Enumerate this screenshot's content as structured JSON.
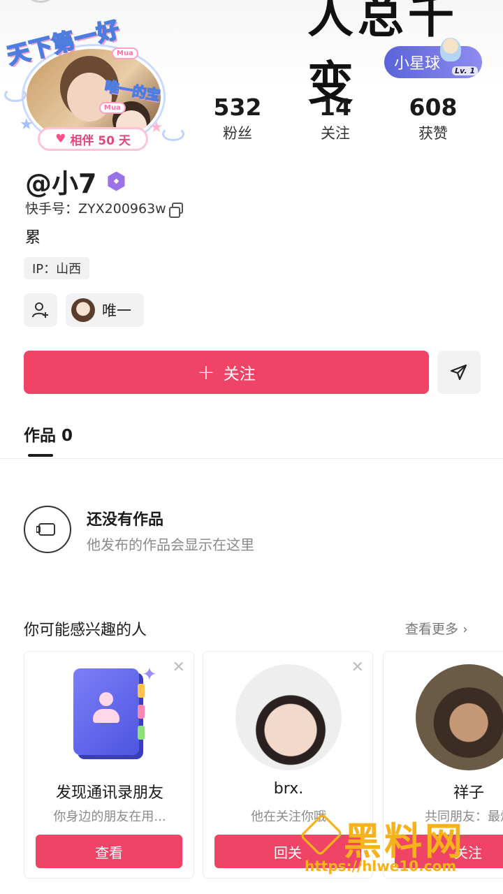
{
  "header": {
    "handwriting_title": "人总千变",
    "planet_badge": {
      "label": "小星球",
      "level": "Lv. 1"
    }
  },
  "avatar": {
    "sticker_title": "天下第一好",
    "sticker_sub": "唯一的宝",
    "mua_label": "Mua",
    "companion_label": "相伴 50 天"
  },
  "stats": [
    {
      "value": "532",
      "label": "粉丝"
    },
    {
      "value": "14",
      "label": "关注"
    },
    {
      "value": "608",
      "label": "获赞"
    }
  ],
  "profile": {
    "nickname": "@小7",
    "kuaishou_id": "快手号：ZYX200963w",
    "bio": "累",
    "ip": "IP：山西",
    "relation_label": "唯一"
  },
  "actions": {
    "follow_label": "关注",
    "follow_plus": "+"
  },
  "tabs": {
    "works_label": "作品",
    "works_count": "0"
  },
  "empty_state": {
    "title": "还没有作品",
    "subtitle": "他发布的作品会显示在这里"
  },
  "suggestions": {
    "title": "你可能感兴趣的人",
    "see_more": "查看更多",
    "cards": [
      {
        "name": "发现通讯录朋友",
        "desc": "你身边的朋友在用...",
        "button": "查看"
      },
      {
        "name": "brx.",
        "desc": "他在关注你哦",
        "button": "回关"
      },
      {
        "name": "祥子",
        "desc": "共同朋友：最烦",
        "button": "关注"
      }
    ]
  },
  "watermark": {
    "text": "黑料网",
    "url": "https://hlwe10.com"
  }
}
